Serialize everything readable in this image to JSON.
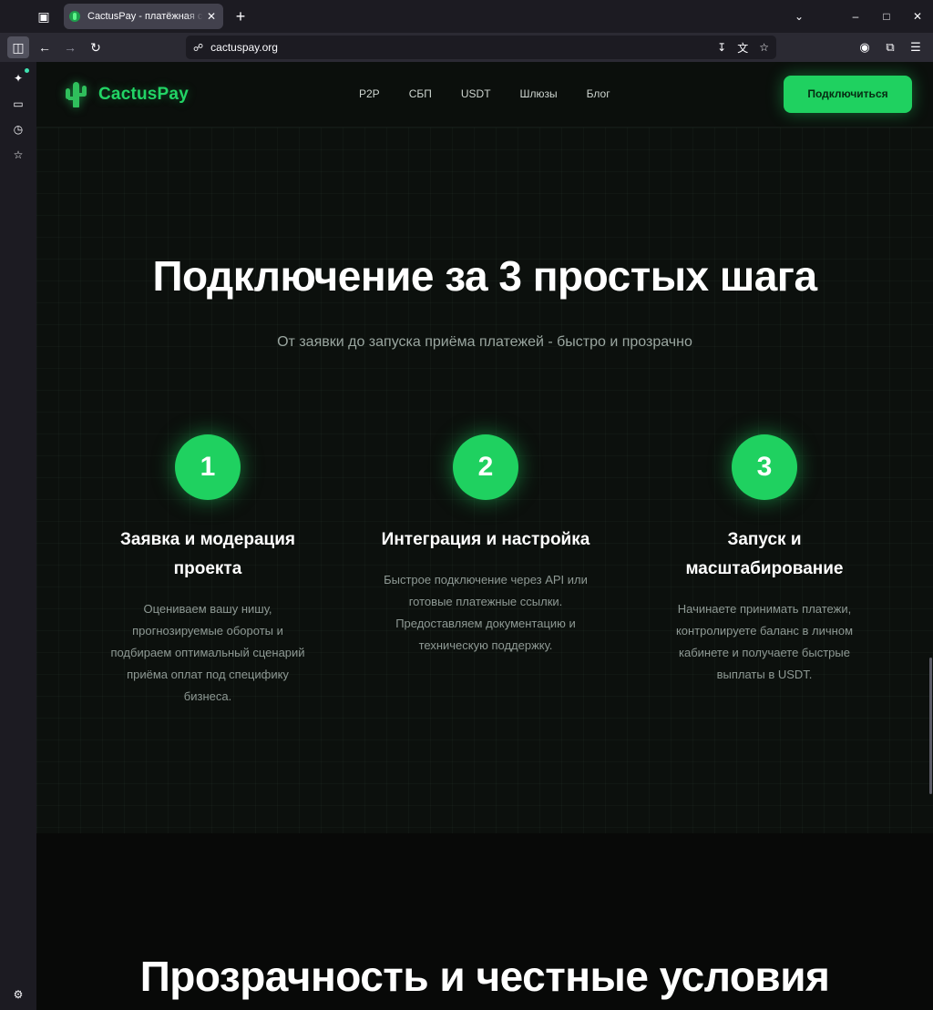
{
  "browser": {
    "tab_title": "CactusPay - платёжная система",
    "url": "cactuspay.org"
  },
  "site": {
    "logo_text": "CactusPay",
    "nav": [
      "P2P",
      "СБП",
      "USDT",
      "Шлюзы",
      "Блог"
    ],
    "cta_label": "Подключиться"
  },
  "steps_section": {
    "title": "Подключение за 3 простых шага",
    "subtitle": "От заявки до запуска приёма платежей - быстро и прозрачно",
    "steps": [
      {
        "number": "1",
        "title": "Заявка и модерация проекта",
        "description": "Оцениваем вашу нишу, прогнозируемые обороты и подбираем оптимальный сценарий приёма оплат под специфику бизнеса."
      },
      {
        "number": "2",
        "title": "Интеграция и настройка",
        "description": "Быстрое подключение через API или готовые платежные ссылки. Предоставляем документацию и техническую поддержку."
      },
      {
        "number": "3",
        "title": "Запуск и масштабирование",
        "description": "Начинаете принимать платежи, контролируете баланс в личном кабинете и получаете быстрые выплаты в USDT."
      }
    ]
  },
  "fair_section": {
    "title": "Прозрачность и честные условия"
  },
  "colors": {
    "accent": "#1fd160",
    "logo": "#22d465",
    "background": "#0a0d0b"
  },
  "icons": {
    "tab_list": "tab-list-icon",
    "close": "close-icon",
    "new_tab": "plus-icon",
    "back": "arrow-left-icon",
    "forward": "arrow-right-icon",
    "reload": "reload-icon",
    "shield": "shield-icon",
    "download": "download-icon",
    "translate": "translate-icon",
    "bookmark": "star-icon",
    "account": "account-icon",
    "extensions": "puzzle-icon",
    "menu": "hamburger-icon"
  }
}
